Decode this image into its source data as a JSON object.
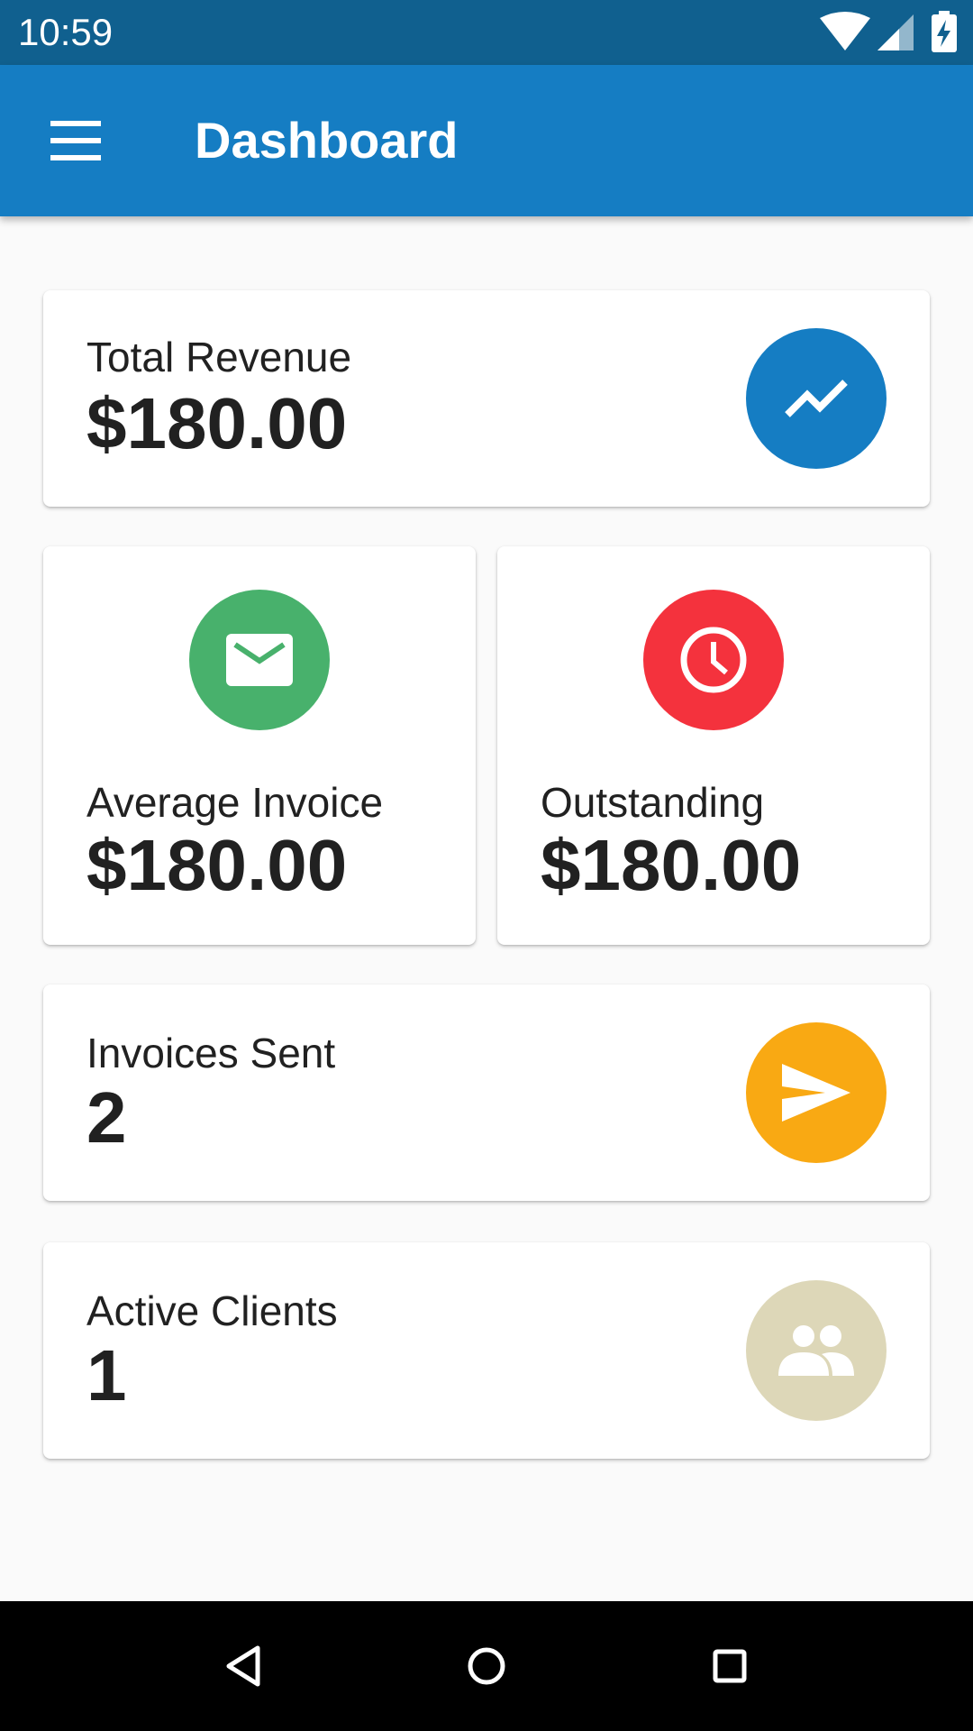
{
  "status_bar": {
    "time": "10:59",
    "icons": [
      "wifi-icon",
      "cell-signal-icon",
      "battery-charging-icon"
    ]
  },
  "app_bar": {
    "title": "Dashboard",
    "menu_icon": "hamburger-menu-icon"
  },
  "cards": {
    "total_revenue": {
      "label": "Total Revenue",
      "value": "$180.00",
      "icon": "trending-up-icon",
      "color": "#157dc3"
    },
    "average_invoice": {
      "label": "Average Invoice",
      "value": "$180.00",
      "icon": "mail-icon",
      "color": "#48b16c"
    },
    "outstanding": {
      "label": "Outstanding",
      "value": "$180.00",
      "icon": "clock-icon",
      "color": "#f4323d"
    },
    "invoices_sent": {
      "label": "Invoices Sent",
      "value": "2",
      "icon": "send-icon",
      "color": "#f9a913"
    },
    "active_clients": {
      "label": "Active Clients",
      "value": "1",
      "icon": "people-icon",
      "color": "#ddd7b8"
    }
  },
  "nav_bar": {
    "icons": [
      "back-icon",
      "home-icon",
      "recents-icon"
    ]
  }
}
